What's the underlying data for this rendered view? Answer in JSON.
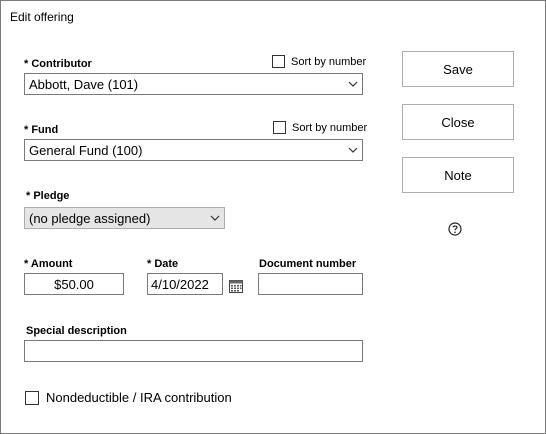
{
  "dialog": {
    "title": "Edit offering"
  },
  "contributor": {
    "label": "* Contributor",
    "sort_label": "Sort by number",
    "value": "Abbott, Dave (101)"
  },
  "fund": {
    "label": "* Fund",
    "sort_label": "Sort by number",
    "value": "General Fund (100)"
  },
  "pledge": {
    "label": "* Pledge",
    "value": "(no pledge assigned)"
  },
  "amount": {
    "label": "* Amount",
    "value": "$50.00"
  },
  "date": {
    "label": "* Date",
    "value": "4/10/2022"
  },
  "document": {
    "label": "Document number",
    "value": ""
  },
  "special": {
    "label": "Special description",
    "value": ""
  },
  "nondeductible": {
    "label": "Nondeductible / IRA contribution"
  },
  "buttons": {
    "save": "Save",
    "close": "Close",
    "note": "Note"
  },
  "icons": {
    "chevron": "chevron-down-icon",
    "calendar": "calendar-icon",
    "help": "help-icon"
  }
}
